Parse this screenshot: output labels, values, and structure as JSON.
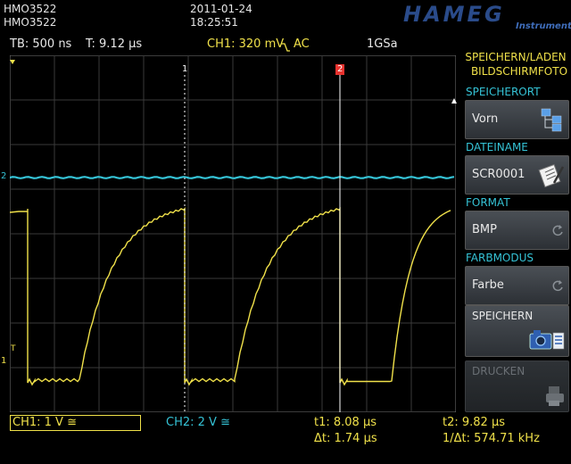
{
  "header": {
    "model_line1": "HMO3522",
    "model_line2": "HMO3522",
    "date": "2011-01-24",
    "time": "18:25:51",
    "brand": "HAMEG",
    "brand_sub": "Instruments"
  },
  "status_bar": {
    "timebase": "TB: 500 ns",
    "trigger_time": "T: 9.12 µs",
    "trigger_source": "CH1: 320 mV",
    "trigger_mode": "AC",
    "sample_rate": "1GSa"
  },
  "scope": {
    "cursor1_label": "1",
    "cursor2_label": "2",
    "ch2_marker": "2",
    "ch1_marker": "1",
    "trigger_marker_left": "T"
  },
  "bottom_bar": {
    "ch1": "CH1: 1 V ≅",
    "ch2": "CH2: 2 V ≅",
    "t1": "t1: 8.08 µs",
    "dt": "Δt: 1.74 µs",
    "t2": "t2: 9.82 µs",
    "inv_dt": "1/Δt: 574.71 kHz"
  },
  "menu": {
    "title_line1": "SPEICHERN/LADEN",
    "title_line2": "BILDSCHIRMFOTO",
    "speicherort_label": "SPEICHERORT",
    "speicherort_value": "Vorn",
    "dateiname_label": "DATEINAME",
    "dateiname_value": "SCR0001",
    "format_label": "FORMAT",
    "format_value": "BMP",
    "farbmodus_label": "FARBMODUS",
    "farbmodus_value": "Farbe",
    "speichern_label": "SPEICHERN",
    "drucken_label": "DRUCKEN"
  },
  "colors": {
    "ch1": "#f0e14a",
    "ch2": "#35c3d6",
    "cursor2": "#e8322e",
    "grid": "#3a3a3a"
  }
}
